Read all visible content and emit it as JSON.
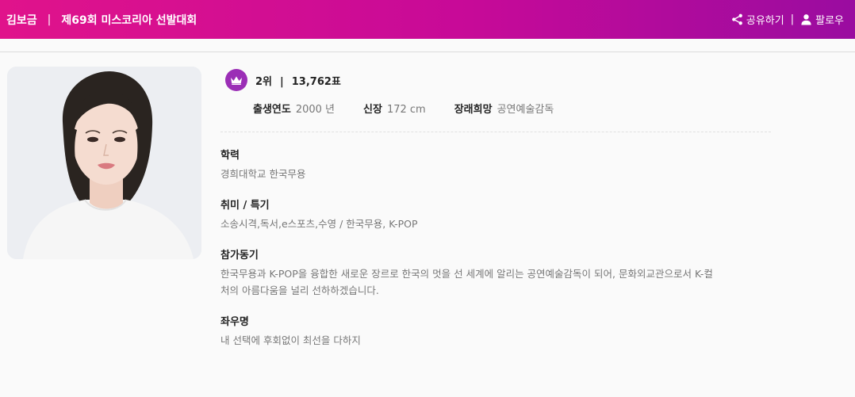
{
  "header": {
    "name": "김보금",
    "separator": "|",
    "event": "제69회 미스코리아 선발대회",
    "share_label": "공유하기",
    "divider": "|",
    "follow_label": "팔로우"
  },
  "profile": {
    "photo_alt": "김보금",
    "rank": "2위",
    "rank_sep": "|",
    "votes": "13,762표",
    "stats": {
      "birth_label": "출생연도",
      "birth_value": "2000 년",
      "height_label": "신장",
      "height_value": "172 cm",
      "dream_label": "장래희망",
      "dream_value": "공연예술감독"
    }
  },
  "sections": {
    "education_title": "학력",
    "education_text": "경희대학교 한국무용",
    "hobby_title": "취미 / 특기",
    "hobby_text": "소송시격,독서,e스포츠,수영 / 한국무용, K-POP",
    "motive_title": "참가동기",
    "motive_line1": "한국무용과 K-POP을 융합한 새로운 장르로 한국의 멋을 선 세계에 알리는 공연예술감독이 되어, 문화외교관으로서 K-컬",
    "motive_line2": "처의 아름다움을 널리 선하하겠습니다.",
    "motto_title": "좌우명",
    "motto_text": "내 선택에 후회없이 최선을 다하지"
  },
  "colors": {
    "header_gradient_start": "#e0138b",
    "header_gradient_end": "#9a0ca0",
    "crown_badge": "#9b2eb6"
  },
  "icons": [
    "share-icon",
    "person-icon",
    "crown-icon"
  ]
}
